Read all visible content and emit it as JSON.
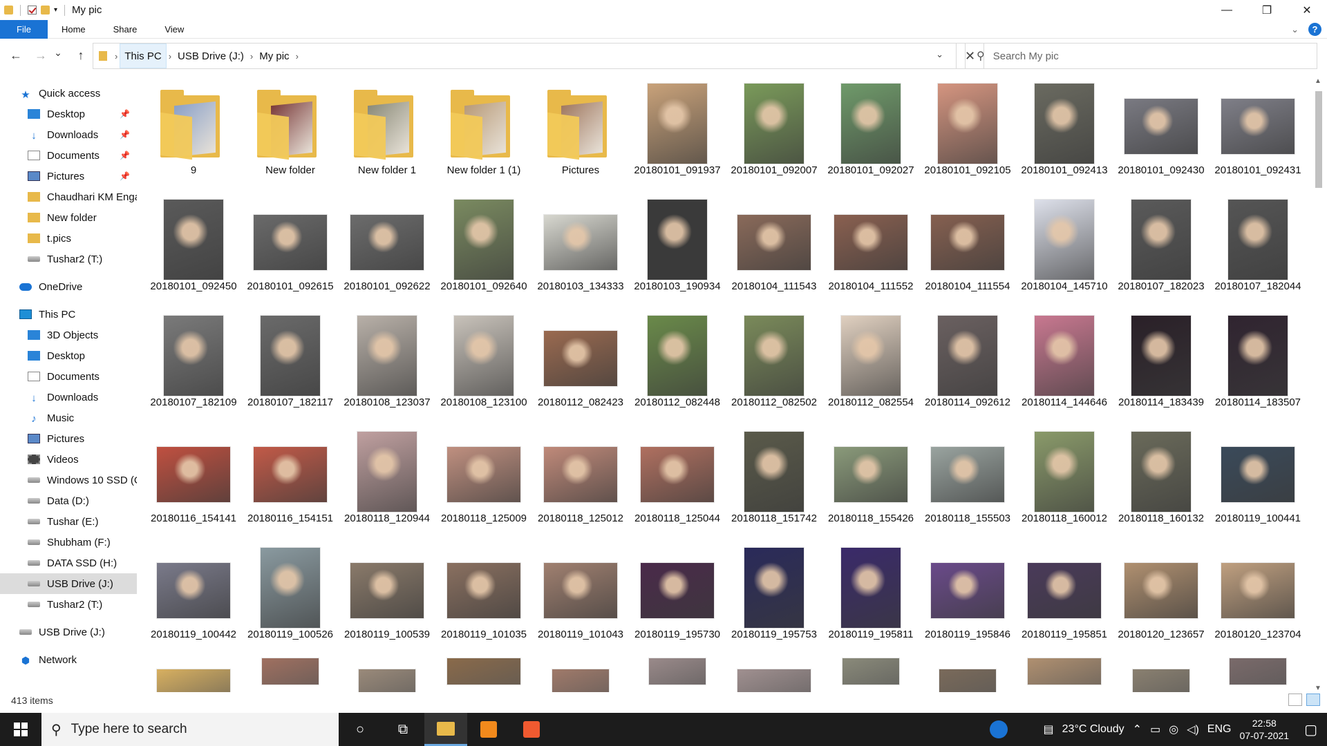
{
  "window": {
    "title": "My pic",
    "minimize": "—",
    "maximize": "❐",
    "close": "✕"
  },
  "ribbon": {
    "tabs": [
      "File",
      "Home",
      "Share",
      "View"
    ],
    "help": "?"
  },
  "address": {
    "crumbs": [
      "This PC",
      "USB Drive (J:)",
      "My pic"
    ],
    "back": "←",
    "forward": "→",
    "recent": "⌄",
    "up": "↑"
  },
  "search": {
    "placeholder": "Search My pic"
  },
  "nav": {
    "items": [
      {
        "label": "Quick access",
        "icon": "star-icon",
        "indent": 0,
        "pin": false
      },
      {
        "label": "Desktop",
        "icon": "desktop-icon",
        "indent": 1,
        "pin": true
      },
      {
        "label": "Downloads",
        "icon": "download-icon",
        "indent": 1,
        "pin": true
      },
      {
        "label": "Documents",
        "icon": "document-icon",
        "indent": 1,
        "pin": true
      },
      {
        "label": "Pictures",
        "icon": "pictures-icon",
        "indent": 1,
        "pin": true
      },
      {
        "label": "Chaudhari KM Enga",
        "icon": "folder-icon",
        "indent": 1,
        "pin": false
      },
      {
        "label": "New folder",
        "icon": "folder-icon",
        "indent": 1,
        "pin": false
      },
      {
        "label": "t.pics",
        "icon": "folder-icon",
        "indent": 1,
        "pin": false
      },
      {
        "label": "Tushar2 (T:)",
        "icon": "drive-icon",
        "indent": 1,
        "pin": false
      },
      {
        "label": "OneDrive",
        "icon": "cloud-icon",
        "indent": 0,
        "pin": false
      },
      {
        "label": "This PC",
        "icon": "pc-icon",
        "indent": 0,
        "pin": false
      },
      {
        "label": "3D Objects",
        "icon": "3d-objects-icon",
        "indent": 1,
        "pin": false
      },
      {
        "label": "Desktop",
        "icon": "desktop-icon",
        "indent": 1,
        "pin": false
      },
      {
        "label": "Documents",
        "icon": "document-icon",
        "indent": 1,
        "pin": false
      },
      {
        "label": "Downloads",
        "icon": "download-icon",
        "indent": 1,
        "pin": false
      },
      {
        "label": "Music",
        "icon": "music-icon",
        "indent": 1,
        "pin": false
      },
      {
        "label": "Pictures",
        "icon": "pictures-icon",
        "indent": 1,
        "pin": false
      },
      {
        "label": "Videos",
        "icon": "videos-icon",
        "indent": 1,
        "pin": false
      },
      {
        "label": "Windows 10 SSD (C",
        "icon": "drive-icon",
        "indent": 1,
        "pin": false
      },
      {
        "label": "Data (D:)",
        "icon": "drive-icon",
        "indent": 1,
        "pin": false
      },
      {
        "label": "Tushar (E:)",
        "icon": "drive-icon",
        "indent": 1,
        "pin": false
      },
      {
        "label": "Shubham (F:)",
        "icon": "drive-icon",
        "indent": 1,
        "pin": false
      },
      {
        "label": "DATA SSD (H:)",
        "icon": "drive-icon",
        "indent": 1,
        "pin": false
      },
      {
        "label": "USB Drive (J:)",
        "icon": "drive-icon",
        "indent": 1,
        "pin": false,
        "selected": true
      },
      {
        "label": "Tushar2 (T:)",
        "icon": "drive-icon",
        "indent": 1,
        "pin": false
      },
      {
        "label": "USB Drive (J:)",
        "icon": "drive-icon",
        "indent": 0,
        "pin": false
      },
      {
        "label": "Network",
        "icon": "network-icon",
        "indent": 0,
        "pin": false
      }
    ]
  },
  "files": [
    {
      "label": "9",
      "type": "folder",
      "color": "#8aa0c8"
    },
    {
      "label": "New folder",
      "type": "folder",
      "color": "#7a3a3a"
    },
    {
      "label": "New folder 1",
      "type": "folder",
      "color": "#8a8a78"
    },
    {
      "label": "New folder 1 (1)",
      "type": "folder",
      "color": "#b89a78"
    },
    {
      "label": "Pictures",
      "type": "folder",
      "color": "#a07860"
    },
    {
      "label": "20180101_091937",
      "type": "p",
      "color": "#c9a27a"
    },
    {
      "label": "20180101_092007",
      "type": "p",
      "color": "#7a9a5a"
    },
    {
      "label": "20180101_092027",
      "type": "p",
      "color": "#6f9a6a"
    },
    {
      "label": "20180101_092105",
      "type": "p",
      "color": "#d59580"
    },
    {
      "label": "20180101_092413",
      "type": "p",
      "color": "#6a6a60"
    },
    {
      "label": "20180101_092430",
      "type": "l",
      "color": "#7a7a82"
    },
    {
      "label": "20180101_092431",
      "type": "l",
      "color": "#7f7f88"
    },
    {
      "label": "20180101_092450",
      "type": "p",
      "color": "#5a5a5a"
    },
    {
      "label": "20180101_092615",
      "type": "l",
      "color": "#6a6a6a"
    },
    {
      "label": "20180101_092622",
      "type": "l",
      "color": "#6c6c6c"
    },
    {
      "label": "20180101_092640",
      "type": "p",
      "color": "#7a8a60"
    },
    {
      "label": "20180103_134333",
      "type": "l",
      "color": "#d8d8d0"
    },
    {
      "label": "20180103_190934",
      "type": "p",
      "color": "#3a3a3a"
    },
    {
      "label": "20180104_111543",
      "type": "l",
      "color": "#8a6a5a"
    },
    {
      "label": "20180104_111552",
      "type": "l",
      "color": "#8a6050"
    },
    {
      "label": "20180104_111554",
      "type": "l",
      "color": "#866050"
    },
    {
      "label": "20180104_145710",
      "type": "p",
      "color": "#dde0ea"
    },
    {
      "label": "20180107_182023",
      "type": "p",
      "color": "#5a5a5a"
    },
    {
      "label": "20180107_182044",
      "type": "p",
      "color": "#555555"
    },
    {
      "label": "20180107_182109",
      "type": "p",
      "color": "#7a7a7a"
    },
    {
      "label": "20180107_182117",
      "type": "p",
      "color": "#6a6a6a"
    },
    {
      "label": "20180108_123037",
      "type": "p",
      "color": "#b8b0a8"
    },
    {
      "label": "20180108_123100",
      "type": "p",
      "color": "#c8c2ba"
    },
    {
      "label": "20180112_082423",
      "type": "l",
      "color": "#9a6a50"
    },
    {
      "label": "20180112_082448",
      "type": "p",
      "color": "#6a8a4a"
    },
    {
      "label": "20180112_082502",
      "type": "p",
      "color": "#7a8a5a"
    },
    {
      "label": "20180112_082554",
      "type": "p",
      "color": "#e0d0c0"
    },
    {
      "label": "20180114_092612",
      "type": "p",
      "color": "#6a6060"
    },
    {
      "label": "20180114_144646",
      "type": "p",
      "color": "#c87890"
    },
    {
      "label": "20180114_183439",
      "type": "p",
      "color": "#2a2028"
    },
    {
      "label": "20180114_183507",
      "type": "p",
      "color": "#302430"
    },
    {
      "label": "20180116_154141",
      "type": "l",
      "color": "#c05040"
    },
    {
      "label": "20180116_154151",
      "type": "l",
      "color": "#c25a48"
    },
    {
      "label": "20180118_120944",
      "type": "p",
      "color": "#c0a0a0"
    },
    {
      "label": "20180118_125009",
      "type": "l",
      "color": "#c09080"
    },
    {
      "label": "20180118_125012",
      "type": "l",
      "color": "#c08a7a"
    },
    {
      "label": "20180118_125044",
      "type": "l",
      "color": "#b07060"
    },
    {
      "label": "20180118_151742",
      "type": "p",
      "color": "#5a5a4a"
    },
    {
      "label": "20180118_155426",
      "type": "l",
      "color": "#8a9a7a"
    },
    {
      "label": "20180118_155503",
      "type": "l",
      "color": "#9aa4a0"
    },
    {
      "label": "20180118_160012",
      "type": "p",
      "color": "#8a9a6a"
    },
    {
      "label": "20180118_160132",
      "type": "p",
      "color": "#6a6a5a"
    },
    {
      "label": "20180119_100441",
      "type": "l",
      "color": "#3a4a5a"
    },
    {
      "label": "20180119_100442",
      "type": "l",
      "color": "#7a7a8a"
    },
    {
      "label": "20180119_100526",
      "type": "p",
      "color": "#8a9aa0"
    },
    {
      "label": "20180119_100539",
      "type": "l",
      "color": "#8a7a6a"
    },
    {
      "label": "20180119_101035",
      "type": "l",
      "color": "#8a7060"
    },
    {
      "label": "20180119_101043",
      "type": "l",
      "color": "#a08070"
    },
    {
      "label": "20180119_195730",
      "type": "l",
      "color": "#4a2a4a"
    },
    {
      "label": "20180119_195753",
      "type": "p",
      "color": "#2a2a5a"
    },
    {
      "label": "20180119_195811",
      "type": "p",
      "color": "#3a2a6a"
    },
    {
      "label": "20180119_195846",
      "type": "l",
      "color": "#6a4a8a"
    },
    {
      "label": "20180119_195851",
      "type": "l",
      "color": "#4a3a5a"
    },
    {
      "label": "20180120_123657",
      "type": "l",
      "color": "#b09070"
    },
    {
      "label": "20180120_123704",
      "type": "l",
      "color": "#c0a080"
    }
  ],
  "partial_row": [
    "#d8b060",
    "#a07060",
    "#9a8a7a",
    "#8a6a4a",
    "#a07a6a",
    "#9a8a8a",
    "#a09090",
    "#8a8a7a",
    "#7a6a5a",
    "#b09070",
    "#8a8070",
    "#7a6a6a",
    "#dde8f5"
  ],
  "status": {
    "count": "413 items"
  },
  "taskbar": {
    "search_placeholder": "Type here to search",
    "weather": "23°C  Cloudy",
    "lang": "ENG",
    "time": "22:58",
    "date": "07-07-2021"
  }
}
